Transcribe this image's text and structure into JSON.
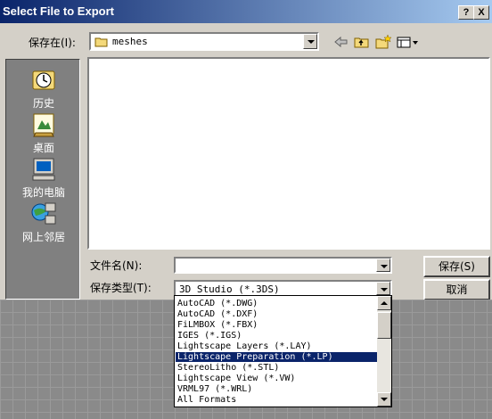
{
  "window": {
    "title": "Select File to Export",
    "help_button": "?",
    "close_button": "X"
  },
  "save_in": {
    "label": "保存在(I):",
    "folder": "meshes"
  },
  "places": [
    {
      "label": "历史",
      "icon": "history-icon"
    },
    {
      "label": "桌面",
      "icon": "desktop-icon"
    },
    {
      "label": "我的电脑",
      "icon": "my-computer-icon"
    },
    {
      "label": "网上邻居",
      "icon": "network-icon"
    }
  ],
  "filename": {
    "label": "文件名(N):",
    "value": ""
  },
  "filetype": {
    "label": "保存类型(T):",
    "selected": "3D Studio (*.3DS)",
    "options": [
      "AutoCAD (*.DWG)",
      "AutoCAD (*.DXF)",
      "FiLMBOX (*.FBX)",
      "IGES (*.IGS)",
      "Lightscape Layers (*.LAY)",
      "Lightscape Preparation (*.LP)",
      "StereoLitho (*.STL)",
      "Lightscape View (*.VW)",
      "VRML97 (*.WRL)",
      "All Formats"
    ],
    "highlighted_option": "Lightscape Preparation (*.LP)"
  },
  "buttons": {
    "save": "保存(S)",
    "cancel": "取消"
  }
}
